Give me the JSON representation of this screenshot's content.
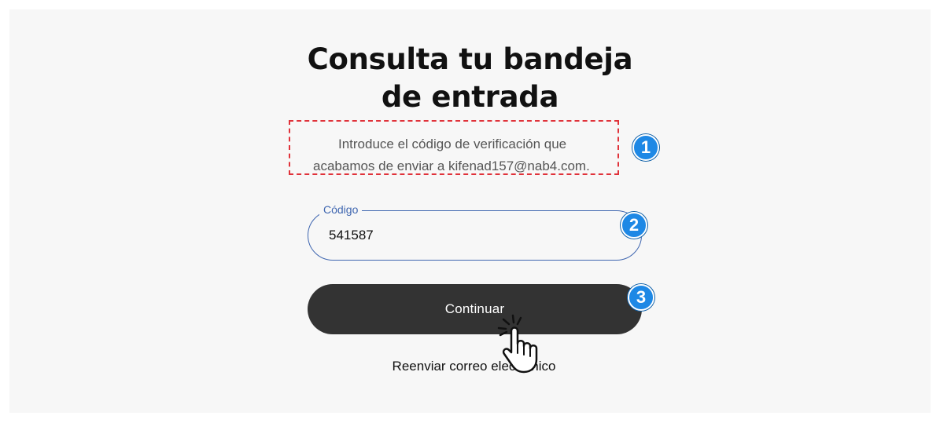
{
  "heading": {
    "line1": "Consulta tu bandeja",
    "line2": "de entrada"
  },
  "description": {
    "line1": "Introduce el código de verificación que",
    "line2": "acabamos de enviar a kifenad157@nab4.com."
  },
  "code_field": {
    "label": "Código",
    "value": "541587"
  },
  "continue_button": {
    "label": "Continuar"
  },
  "resend_link": {
    "label": "Reenviar correo electrónico"
  },
  "annotations": {
    "badge_1": "1",
    "badge_2": "2",
    "badge_3": "3",
    "badge_color": "#1e88e5",
    "highlight_color": "#e0323a"
  },
  "icons": {
    "pointer": "hand-pointer-icon"
  }
}
